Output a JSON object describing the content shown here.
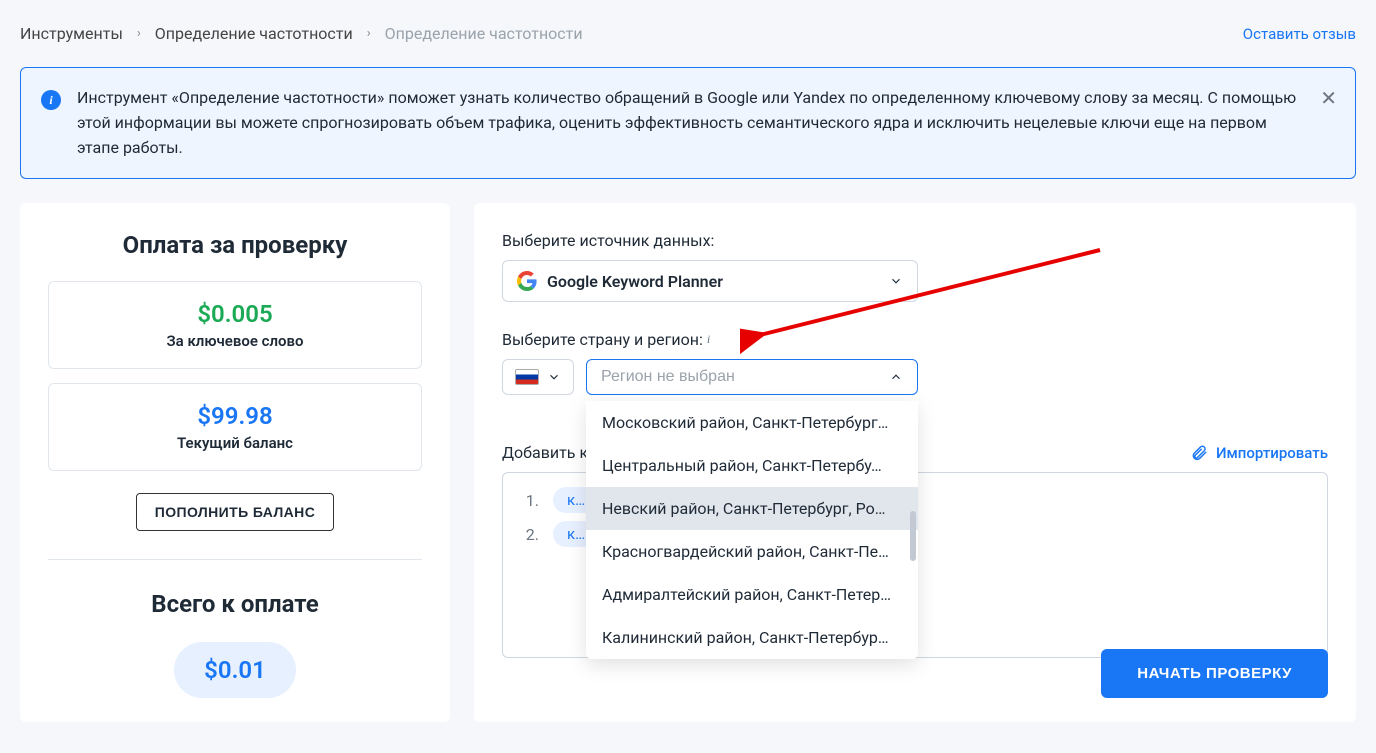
{
  "breadcrumb": {
    "items": [
      "Инструменты",
      "Определение частотности",
      "Определение частотности"
    ]
  },
  "feedback_link": "Оставить отзыв",
  "info_banner": "Инструмент «Определение частотности» поможет узнать количество обращений в Google или Yandex по определенному ключевому слову за месяц. С помощью этой информации вы можете спрогнозировать объем трафика, оценить эффективность семантического ядра и исключить нецелевые ключи еще на первом этапе работы.",
  "sidebar": {
    "title": "Оплата за проверку",
    "price_per_kw": {
      "value": "$0.005",
      "label": "За ключевое слово"
    },
    "balance": {
      "value": "$99.98",
      "label": "Текущий баланс"
    },
    "topup_button": "ПОПОЛНИТЬ БАЛАНС",
    "total_title": "Всего к оплате",
    "total_value": "$0.01"
  },
  "content": {
    "source_label": "Выберите источник данных:",
    "source_value": "Google Keyword Planner",
    "region_label": "Выберите страну и регион:",
    "region_placeholder": "Регион не выбран",
    "region_options": [
      "Московский район, Санкт-Петербург…",
      "Центральный район, Санкт-Петербу…",
      "Невский район, Санкт-Петербург, Ро…",
      "Красногвардейский район, Санкт-Пе…",
      "Адмиралтейский район, Санкт-Петер…",
      "Калининский район, Санкт-Петербур…"
    ],
    "region_hover_index": 2,
    "keywords_label": "Добавить к",
    "import_label": "Импортировать",
    "keywords": [
      {
        "num": "1.",
        "text": "куп"
      },
      {
        "num": "2.",
        "text": "куп"
      }
    ],
    "start_button": "НАЧАТЬ ПРОВЕРКУ"
  }
}
